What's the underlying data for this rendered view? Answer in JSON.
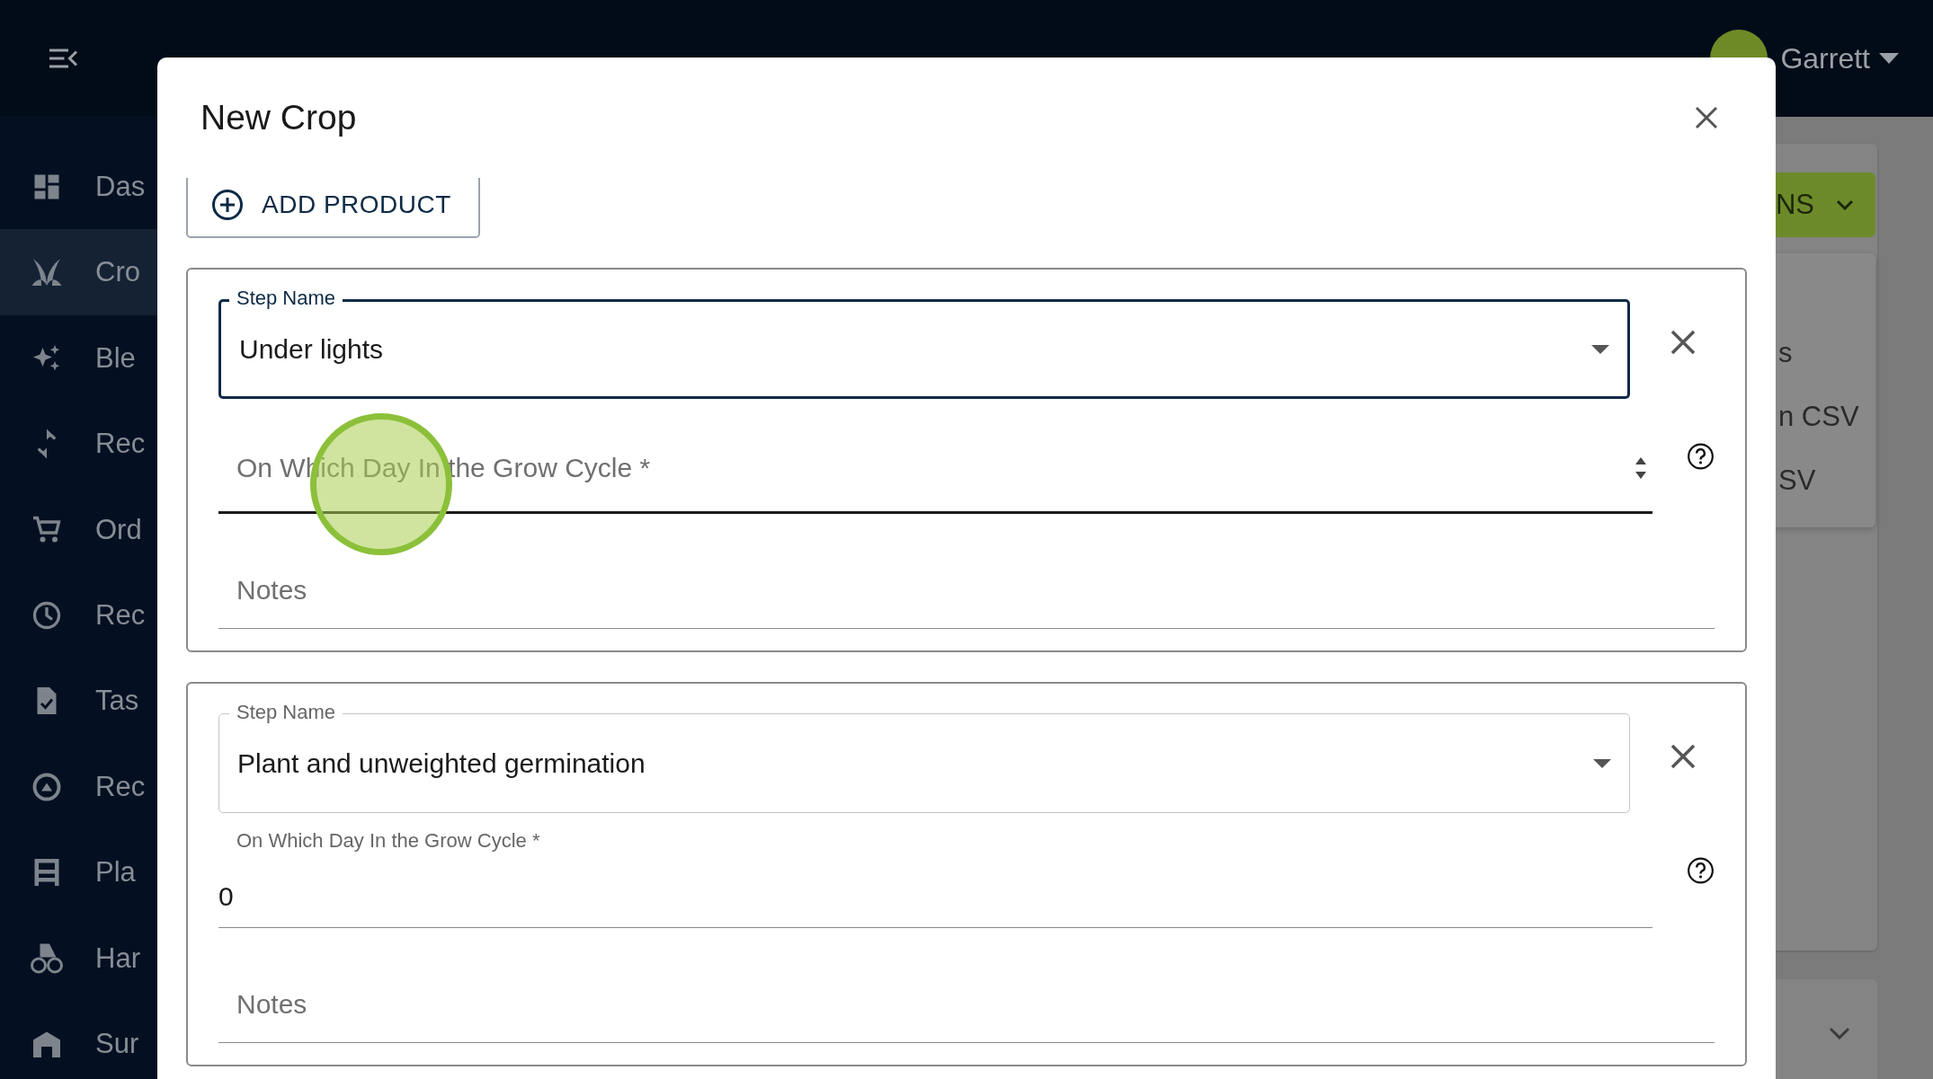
{
  "app": {
    "user": {
      "name": "Garrett"
    }
  },
  "sidebar": {
    "items": [
      {
        "label": "Das",
        "selected": false
      },
      {
        "label": "Cro",
        "selected": true
      },
      {
        "label": "Ble",
        "selected": false
      },
      {
        "label": "Rec",
        "selected": false
      },
      {
        "label": "Ord",
        "selected": false
      },
      {
        "label": "Rec",
        "selected": false
      },
      {
        "label": "Tas",
        "selected": false
      },
      {
        "label": "Rec",
        "selected": false
      },
      {
        "label": "Pla",
        "selected": false
      },
      {
        "label": "Har",
        "selected": false
      },
      {
        "label": "Sur",
        "selected": false
      }
    ]
  },
  "background": {
    "actions_button": "NS",
    "menu_items": [
      "s",
      "n CSV",
      "SV"
    ]
  },
  "dialog": {
    "title": "New Crop",
    "add_product": "ADD PRODUCT",
    "steps": [
      {
        "step_label": "Step Name",
        "step_name": "Under lights",
        "focused": true,
        "day_label": "On Which Day In the Grow Cycle *",
        "day_hovered": true,
        "notes_placeholder": "Notes"
      },
      {
        "step_label": "Step Name",
        "step_name": "Plant and unweighted germination",
        "focused": false,
        "day_label": "On Which Day In the Grow Cycle *",
        "day_value": "0",
        "day_hovered": false,
        "notes_placeholder": "Notes"
      }
    ]
  }
}
